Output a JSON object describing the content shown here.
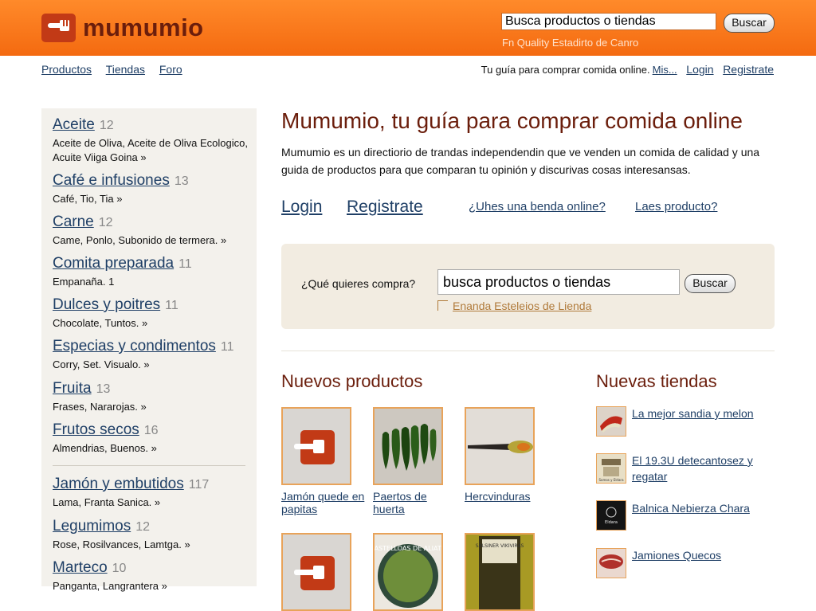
{
  "header": {
    "logo_text": "mumumio",
    "search_value": "Busca productos o tiendas",
    "search_button": "Buscar",
    "subtext": "Fn Quality Estadirto de Canro"
  },
  "topnav": {
    "links": [
      "Productos",
      "Tiendas",
      "Foro"
    ],
    "tagline": "Tu guía para comprar comida online.",
    "more": "Mis...",
    "login": "Login",
    "register": "Registrate"
  },
  "sidebar": {
    "categories": [
      {
        "name": "Aceite",
        "count": "12",
        "sub": "Aceite de Oliva, Aceite de Oliva Ecologico, Acuite Viiga Goina »"
      },
      {
        "name": "Café e infusiones",
        "count": "13",
        "sub": "Café, Tio, Tia »"
      },
      {
        "name": "Carne",
        "count": "12",
        "sub": "Came, Ponlo, Subonido de termera. »"
      },
      {
        "name": "Comita preparada",
        "count": "11",
        "sub": "Empanaña. 1"
      },
      {
        "name": "Dulces y poitres",
        "count": "11",
        "sub": "Chocolate, Tuntos. »"
      },
      {
        "name": "Especias y condimentos",
        "count": "11",
        "sub": "Corry, Set. Visualo. »"
      },
      {
        "name": "Fruita",
        "count": "13",
        "sub": "Frases, Nararojas. »"
      },
      {
        "name": "Frutos secos",
        "count": "16",
        "sub": "Almendrias, Buenos. »"
      },
      {
        "name": "Jamón y embutidos",
        "count": "117",
        "sub": "Lama, Franta Sanica. »"
      },
      {
        "name": "Legumimos",
        "count": "12",
        "sub": "Rose, Rosilvances, Lamtga. »"
      },
      {
        "name": "Marteco",
        "count": "10",
        "sub": "Panganta, Langrantera »"
      }
    ]
  },
  "main": {
    "title": "Mumumio, tu guía para comprar comida online",
    "description": "Mumumio es un directiorio de trandas independendin que ve venden un comida de calidad y una guida de productos para que comparan tu opinión y discurivas cosas interesansas.",
    "login": "Login",
    "register": "Registrate",
    "have_store": "¿Uhes una benda online?",
    "product_q": "Laes producto?",
    "search": {
      "label": "¿Qué quieres compra?",
      "value": "busca productos o tiendas",
      "button": "Buscar",
      "advanced": "Enanda Esteleios de Lienda"
    },
    "new_products_title": "Nuevos productos",
    "new_products": [
      {
        "name": "Jamón quede en papitas"
      },
      {
        "name": "Paertos de huerta"
      },
      {
        "name": "Hercvinduras"
      }
    ],
    "new_stores_title": "Nuevas tiendas",
    "new_stores": [
      {
        "name": "La mejor sandia y melon"
      },
      {
        "name": "El 19.3U detecantosez y regatar"
      },
      {
        "name": "Balnica Nebierza Chara"
      },
      {
        "name": "Jamiones Quecos"
      }
    ],
    "thumb_texts": {
      "store2": "Somos y Eldara",
      "store3": "Eldara",
      "product5": "CASTELLOAS DE ALIATO",
      "product6": "SALSINER VIKIVIRAS"
    }
  },
  "colors": {
    "header_orange": "#f46a10",
    "brand_dark": "#6b1e0c",
    "logo_red": "#c23a16",
    "link": "#1f3f66",
    "sidebar_bg": "#f3f1ec"
  }
}
